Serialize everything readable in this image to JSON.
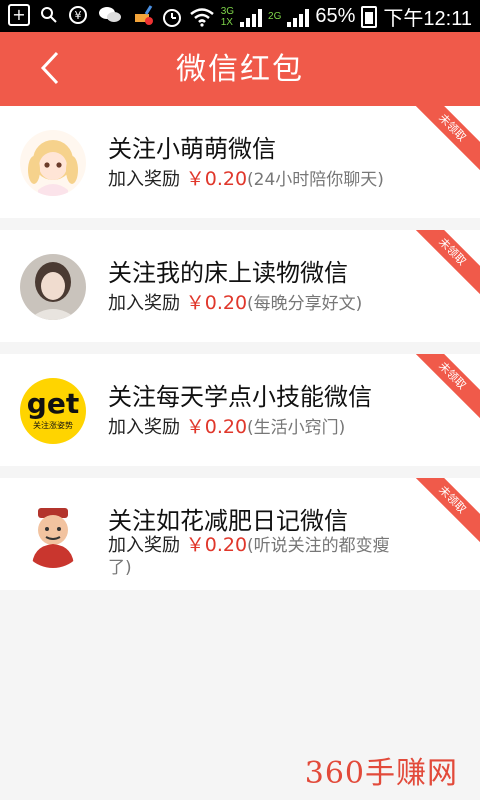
{
  "status_bar": {
    "carrier_icons": [
      "add-icon",
      "search-icon",
      "yuan-icon",
      "wechat-icon",
      "broom-icon"
    ],
    "net_3g": "3G",
    "net_1x": "1X",
    "net_2g": "2G",
    "battery": "65%",
    "time": "下午12:11"
  },
  "header": {
    "title": "微信红包",
    "bg_color": "#f05a4a"
  },
  "items": [
    {
      "title": "关注小萌萌微信",
      "reward_label": "加入奖励",
      "amount": "￥0.20",
      "note": "(24小时陪你聊天)",
      "badge": "未领取"
    },
    {
      "title": "关注我的床上读物微信",
      "reward_label": "加入奖励",
      "amount": "￥0.20",
      "note": "(每晚分享好文)",
      "badge": "未领取"
    },
    {
      "title": "关注每天学点小技能微信",
      "reward_label": "加入奖励",
      "amount": "￥0.20",
      "note": "(生活小窍门)",
      "badge": "未领取",
      "logo_text": "get",
      "logo_sub": "关注涨姿势"
    },
    {
      "title": "关注如花减肥日记微信",
      "reward_label": "加入奖励",
      "amount": "￥0.20",
      "note": "(听说关注的都变瘦了)",
      "badge": "未领取"
    }
  ],
  "watermark": "360手赚网"
}
